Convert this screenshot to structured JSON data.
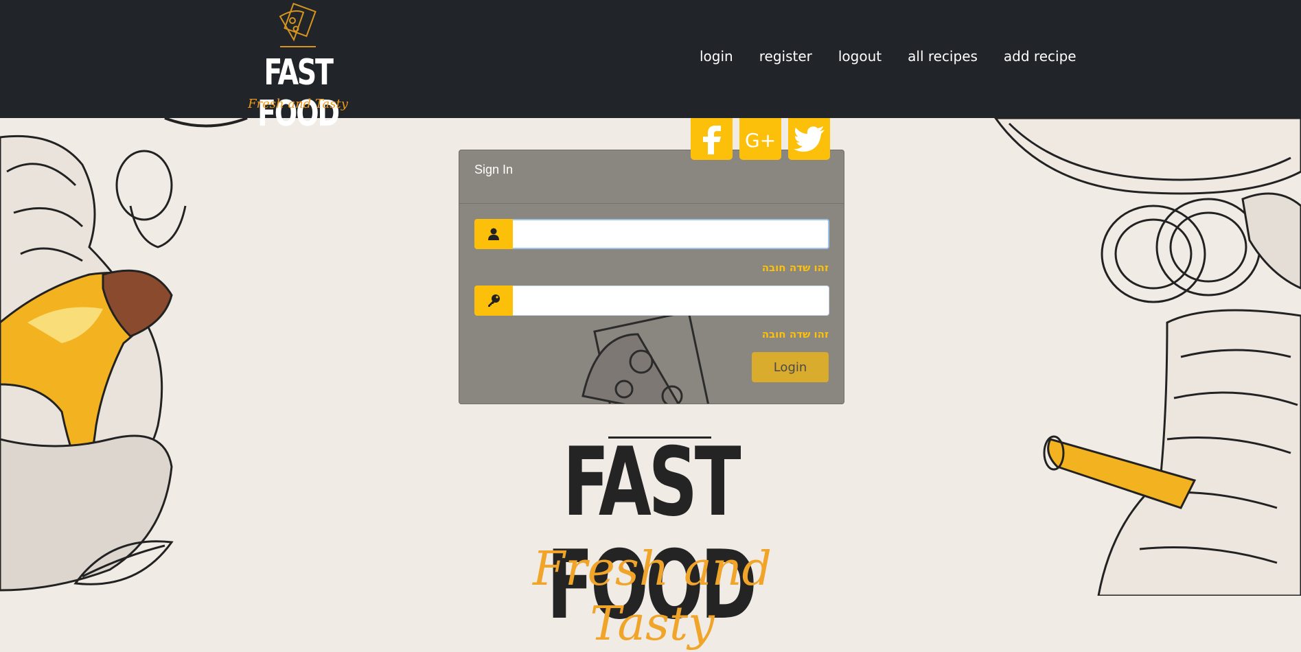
{
  "brand": {
    "title": "FAST FOOD",
    "tagline": "Fresh and Tasty",
    "accent_color": "#ef9a1a"
  },
  "nav": {
    "links": [
      {
        "label": "login"
      },
      {
        "label": "register"
      },
      {
        "label": "logout"
      },
      {
        "label": "all recipes"
      },
      {
        "label": "add recipe"
      }
    ]
  },
  "social": [
    {
      "name": "facebook",
      "icon": "facebook-icon"
    },
    {
      "name": "google-plus",
      "icon": "google-plus-icon"
    },
    {
      "name": "twitter",
      "icon": "twitter-icon"
    }
  ],
  "signin": {
    "title": "Sign In",
    "username": {
      "value": "",
      "placeholder": "",
      "icon": "user-icon",
      "error": "זהו שדה חובה"
    },
    "password": {
      "value": "",
      "placeholder": "",
      "icon": "key-icon",
      "error": "זהו שדה חובה"
    },
    "login_label": "Login"
  },
  "hero": {
    "title": "FAST FOOD",
    "subtitle": "Fresh and Tasty"
  },
  "colors": {
    "navbar": "#212529",
    "accent_yellow": "#fcc00a",
    "card_bg": "#8a8680",
    "page_bg": "#f1ebe6"
  }
}
